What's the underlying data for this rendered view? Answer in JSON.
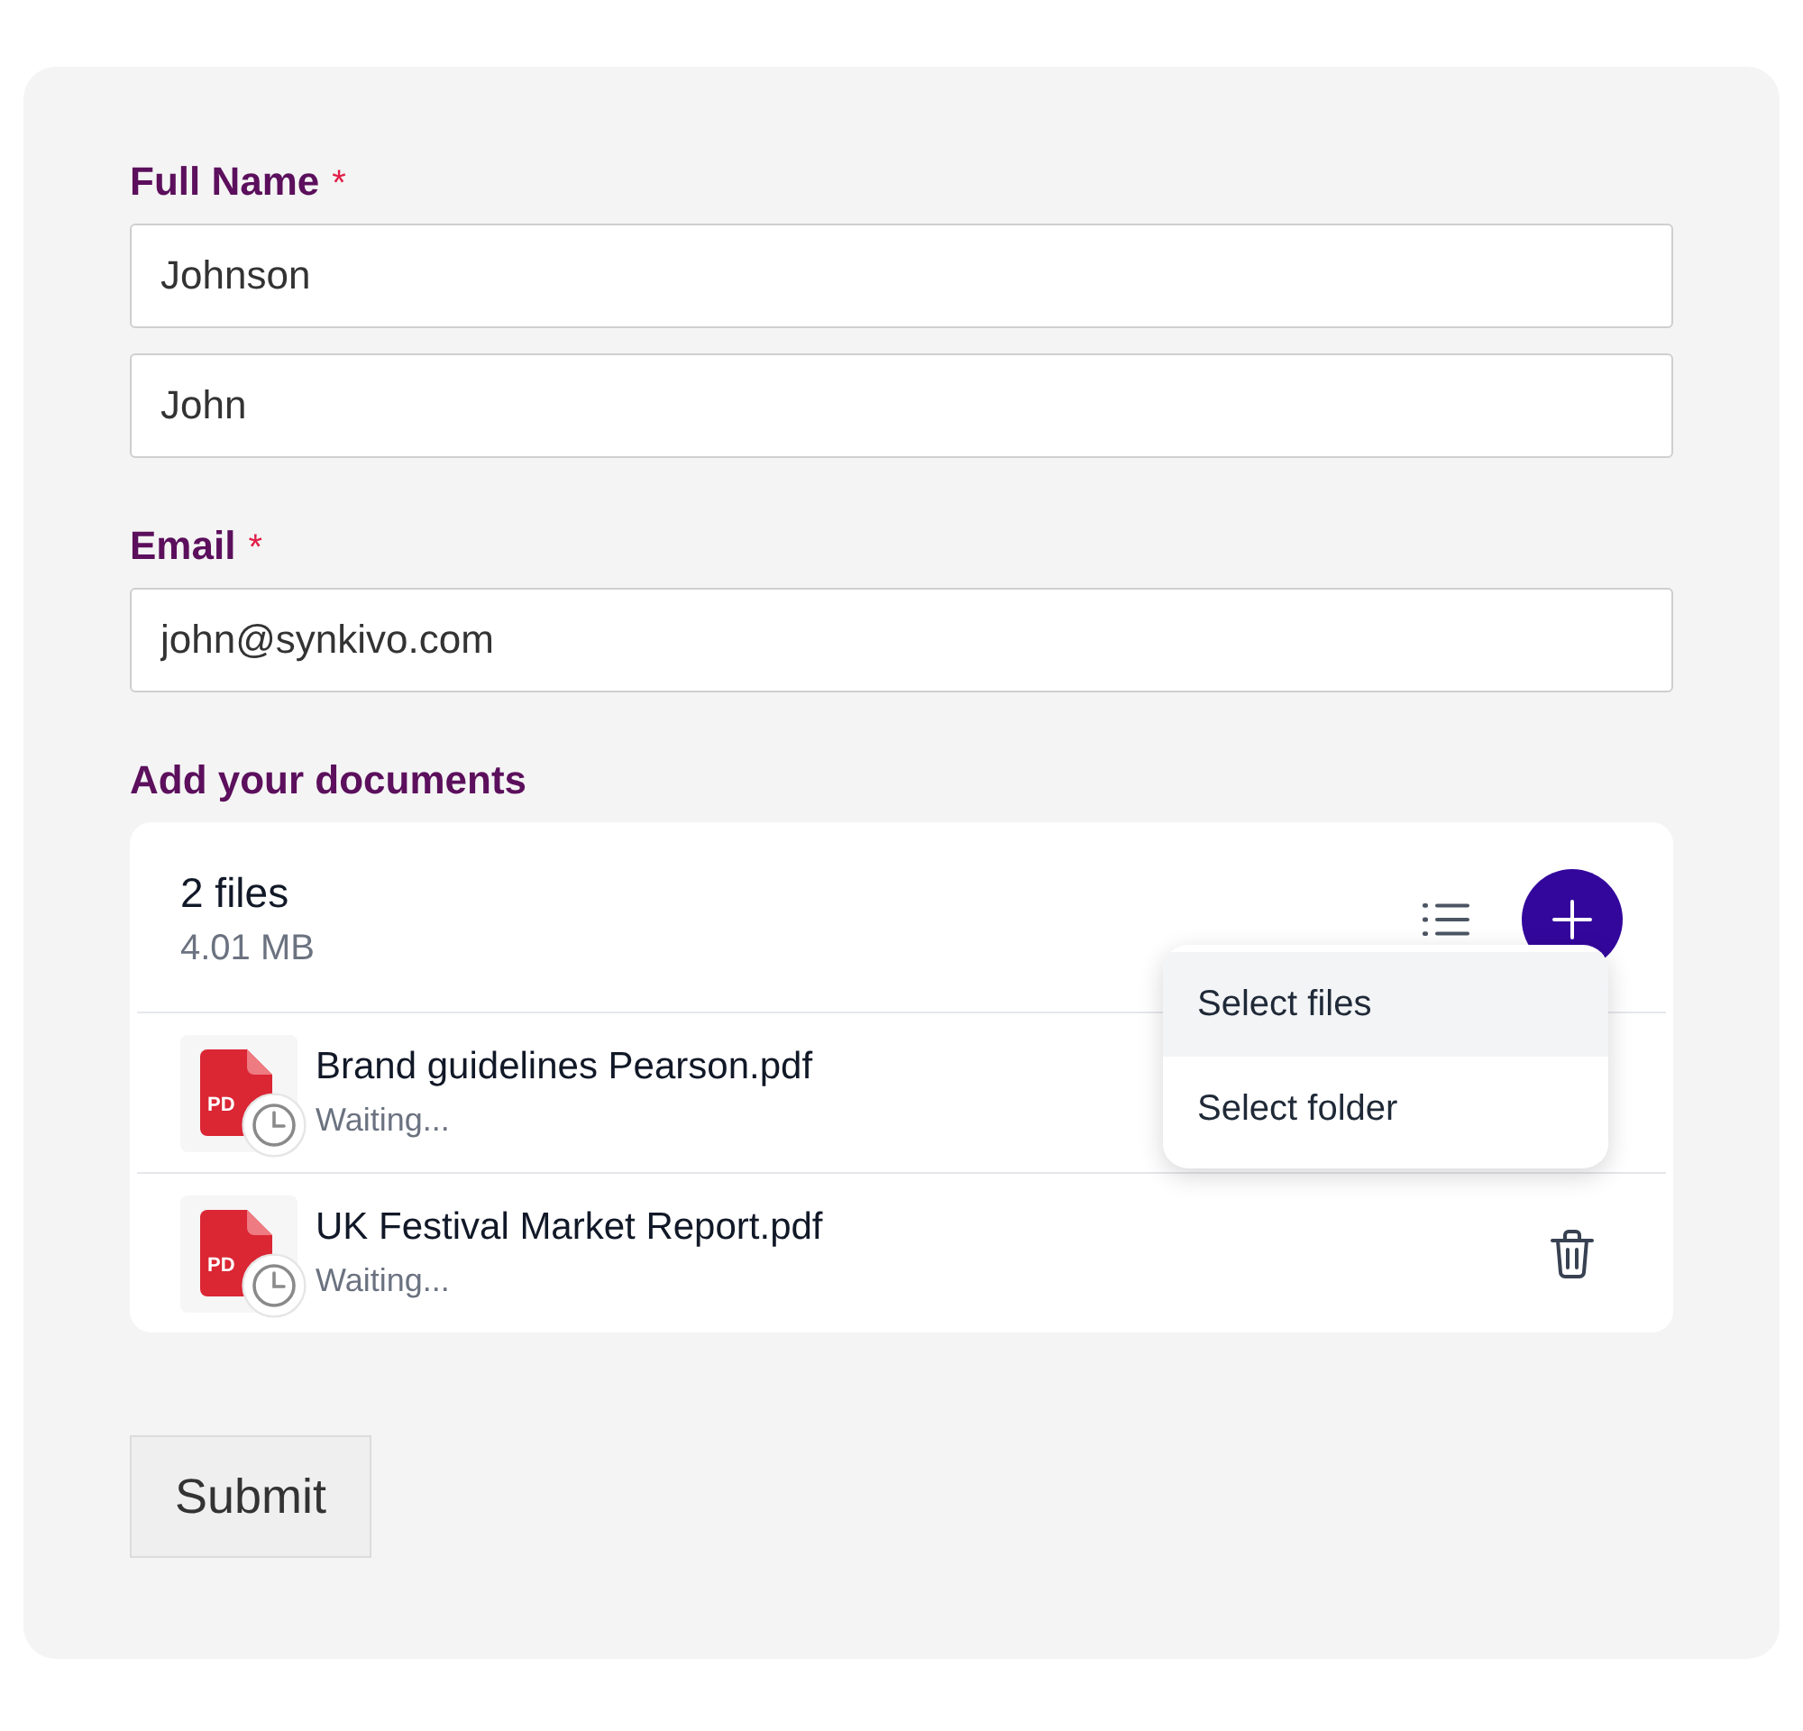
{
  "fields": [
    {
      "label": "Full Name",
      "required_mark": "*",
      "inputs": [
        {
          "value": "Johnson"
        },
        {
          "value": "John"
        }
      ]
    },
    {
      "label": "Email",
      "required_mark": "*",
      "inputs": [
        {
          "value": "john@synkivo.com"
        }
      ]
    }
  ],
  "uploader": {
    "label": "Add your documents",
    "file_count": "2 files",
    "total_size": "4.01 MB",
    "menu": {
      "open": true,
      "items": [
        {
          "label": "Select files",
          "selected": true
        },
        {
          "label": "Select folder",
          "selected": false
        }
      ]
    },
    "files": [
      {
        "name": "Brand guidelines Pearson.pdf",
        "status": "Waiting...",
        "type_label": "PD"
      },
      {
        "name": "UK Festival Market Report.pdf",
        "status": "Waiting...",
        "type_label": "PD"
      }
    ]
  },
  "submit": "Submit"
}
